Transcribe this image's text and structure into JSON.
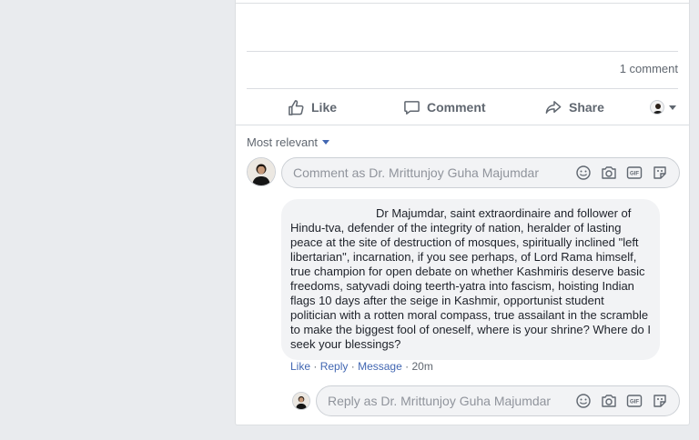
{
  "post": {
    "comment_count": "1 comment",
    "actions": {
      "like": "Like",
      "comment": "Comment",
      "share": "Share"
    },
    "sort_label": "Most relevant"
  },
  "composer": {
    "placeholder": "Comment as Dr. Mrittunjoy Guha Majumdar"
  },
  "comment": {
    "author": "",
    "text": "Dr Majumdar, saint extraordinaire and follower of Hindu-tva, defender of the integrity of nation, heralder of lasting peace at the site of destruction of mosques, spiritually inclined \"left libertarian\", incarnation, if you see perhaps, of Lord Rama himself, true champion for open debate on whether Kashmiris deserve basic freedoms, satyvadi doing teerth-yatra into fascism, hoisting Indian flags 10 days after the seige in Kashmir, opportunist student politician with a rotten moral compass, true assailant in the scramble to make the biggest fool of oneself, where is your shrine? Where do I seek your blessings?",
    "like": "Like",
    "reply": "Reply",
    "message": "Message",
    "time": "20m",
    "sep": "·"
  },
  "reply_box": {
    "placeholder": "Reply as Dr. Mrittunjoy Guha Majumdar"
  },
  "colors": {
    "link": "#4267b2",
    "meta": "#606770",
    "bubble": "#f2f3f5",
    "page_bg": "#e9ebee"
  },
  "icons": [
    "like-icon",
    "comment-icon",
    "share-icon",
    "caret-down-icon",
    "emoji-icon",
    "camera-icon",
    "gif-icon",
    "sticker-icon"
  ]
}
